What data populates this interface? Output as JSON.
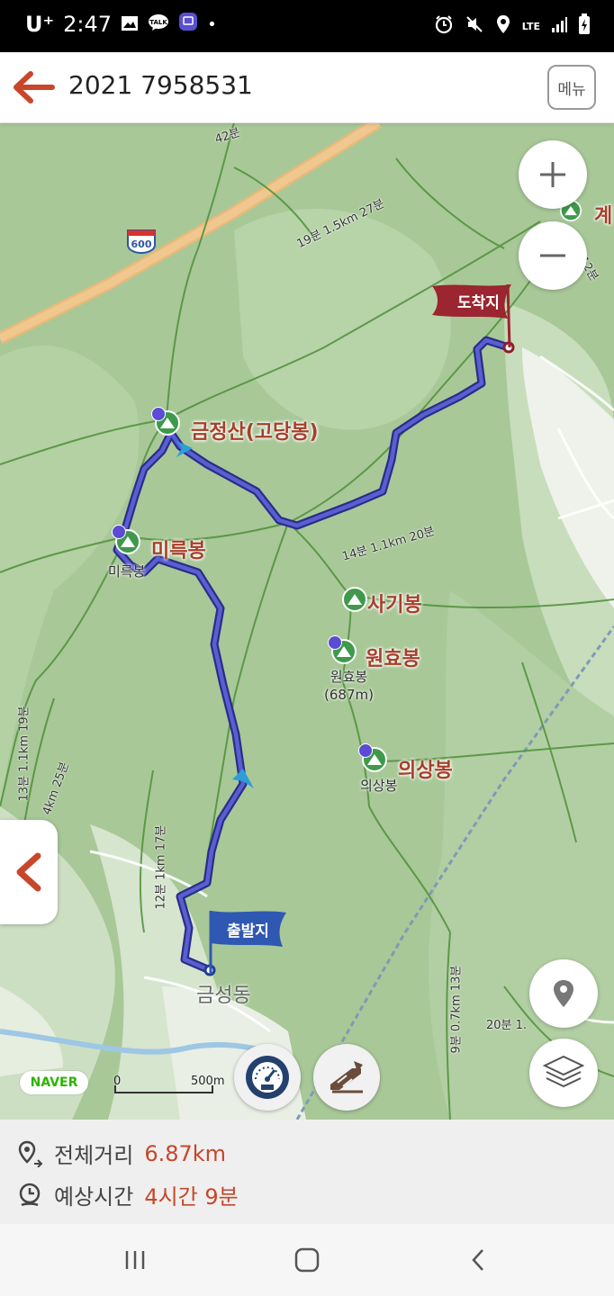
{
  "status_bar": {
    "carrier": "U⁺",
    "time": "2:47",
    "talk_badge": "TALK",
    "network": "LTE"
  },
  "header": {
    "title": "2021 7958531",
    "menu_label": "메뉴"
  },
  "map": {
    "highway_number": "600",
    "peaks": [
      {
        "name": "금정산(고당봉)"
      },
      {
        "name": "미륵봉",
        "sub": "미륵봉"
      },
      {
        "name": "사기봉"
      },
      {
        "name": "원효봉",
        "sub": "원효봉\n(687m)"
      },
      {
        "name": "의상봉",
        "sub": "의상봉"
      },
      {
        "name": "계"
      }
    ],
    "trail_labels": [
      "42분",
      "19분 1.5km 27분",
      "14분 1.1km 20분",
      "13분 1.1km 19분",
      "12분 1km 17분",
      "4km 25분",
      "9분 0.7km 13분",
      "20분 1.",
      "12분"
    ],
    "end_flag": "도착지",
    "start_flag": "출발지",
    "town": "금성동",
    "logo": "NAVER",
    "scale_start": "0",
    "scale_end": "500m",
    "route_color": "#3c3fa8"
  },
  "info": {
    "distance_label": "전체거리",
    "distance_value": "6.87km",
    "time_label": "예상시간",
    "time_value": "4시간 9분"
  },
  "colors": {
    "accent": "#c8462a",
    "flag_end": "#9b2530",
    "flag_start": "#2f58b2"
  }
}
